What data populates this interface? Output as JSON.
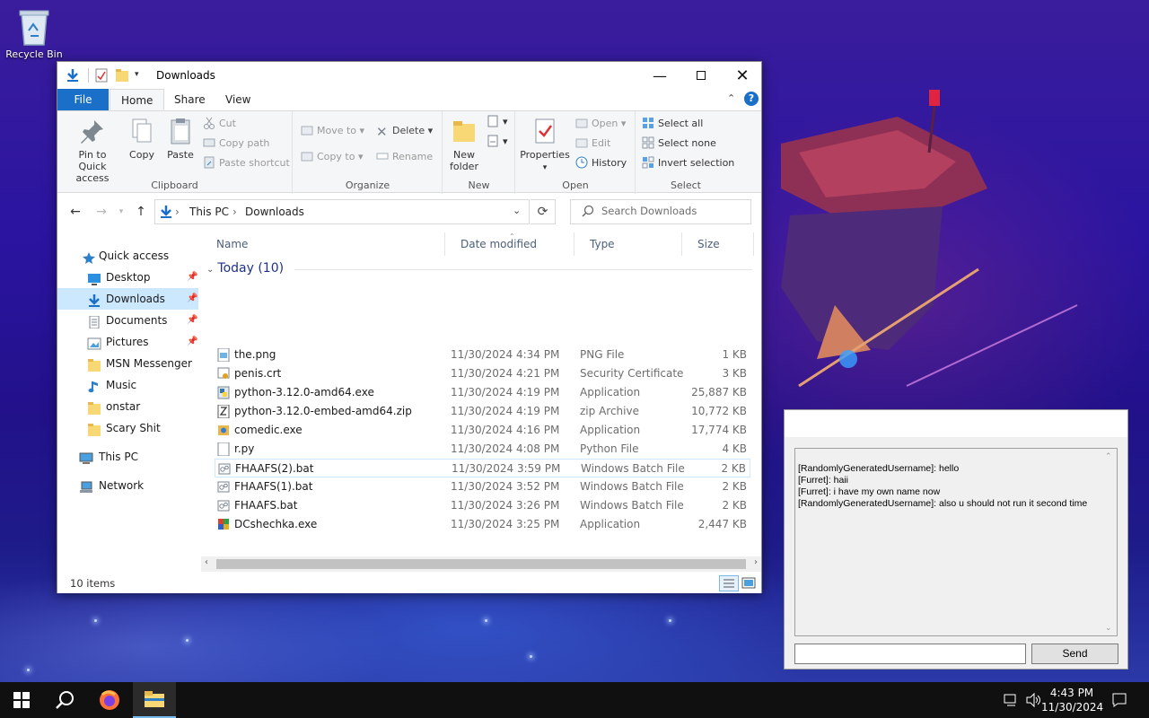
{
  "desktop": {
    "recycle_bin_label": "Recycle Bin"
  },
  "explorer": {
    "title": "Downloads",
    "ribbon_tabs": [
      "File",
      "Home",
      "Share",
      "View"
    ],
    "ribbon": {
      "clipboard": {
        "group": "Clipboard",
        "pin": "Pin to Quick access",
        "copy": "Copy",
        "paste": "Paste",
        "cut": "Cut",
        "copy_path": "Copy path",
        "paste_shortcut": "Paste shortcut"
      },
      "organize": {
        "group": "Organize",
        "move_to": "Move to",
        "copy_to": "Copy to",
        "delete": "Delete",
        "rename": "Rename"
      },
      "new": {
        "group": "New",
        "new_folder": "New folder"
      },
      "open": {
        "group": "Open",
        "properties": "Properties",
        "open": "Open",
        "edit": "Edit",
        "history": "History"
      },
      "select": {
        "group": "Select",
        "select_all": "Select all",
        "select_none": "Select none",
        "invert_selection": "Invert selection"
      }
    },
    "address": {
      "crumbs": [
        "This PC",
        "Downloads"
      ],
      "search_placeholder": "Search Downloads"
    },
    "nav": {
      "quick_access": "Quick access",
      "items": [
        "Desktop",
        "Downloads",
        "Documents",
        "Pictures",
        "MSN Messenger",
        "Music",
        "onstar",
        "Scary Shit"
      ],
      "this_pc": "This PC",
      "network": "Network"
    },
    "columns": [
      "Name",
      "Date modified",
      "Type",
      "Size"
    ],
    "group_label": "Today (10)",
    "files": [
      {
        "name": "the.png",
        "date": "11/30/2024 4:34 PM",
        "type": "PNG File",
        "size": "1 KB"
      },
      {
        "name": "penis.crt",
        "date": "11/30/2024 4:21 PM",
        "type": "Security Certificate",
        "size": "3 KB"
      },
      {
        "name": "python-3.12.0-amd64.exe",
        "date": "11/30/2024 4:19 PM",
        "type": "Application",
        "size": "25,887 KB"
      },
      {
        "name": "python-3.12.0-embed-amd64.zip",
        "date": "11/30/2024 4:19 PM",
        "type": "zip Archive",
        "size": "10,772 KB"
      },
      {
        "name": "comedic.exe",
        "date": "11/30/2024 4:16 PM",
        "type": "Application",
        "size": "17,774 KB"
      },
      {
        "name": "r.py",
        "date": "11/30/2024 4:08 PM",
        "type": "Python File",
        "size": "4 KB"
      },
      {
        "name": "FHAAFS(2).bat",
        "date": "11/30/2024 3:59 PM",
        "type": "Windows Batch File",
        "size": "2 KB"
      },
      {
        "name": "FHAAFS(1).bat",
        "date": "11/30/2024 3:52 PM",
        "type": "Windows Batch File",
        "size": "2 KB"
      },
      {
        "name": "FHAAFS.bat",
        "date": "11/30/2024 3:26 PM",
        "type": "Windows Batch File",
        "size": "2 KB"
      },
      {
        "name": "DCshechka.exe",
        "date": "11/30/2024 3:25 PM",
        "type": "Application",
        "size": "2,447 KB"
      }
    ],
    "status": "10 items"
  },
  "chat": {
    "messages": [
      "[RandomlyGeneratedUsername]: hello",
      "[Furret]: haii",
      "[Furret]: i have my own name now",
      "[RandomlyGeneratedUsername]: also u should not run it second time"
    ],
    "input_value": "",
    "send_label": "Send"
  },
  "taskbar": {
    "time": "4:43 PM",
    "date": "11/30/2024"
  },
  "colors": {
    "accent": "#1a6fc9",
    "selection": "#cce8ff",
    "taskbar": "#101010"
  }
}
